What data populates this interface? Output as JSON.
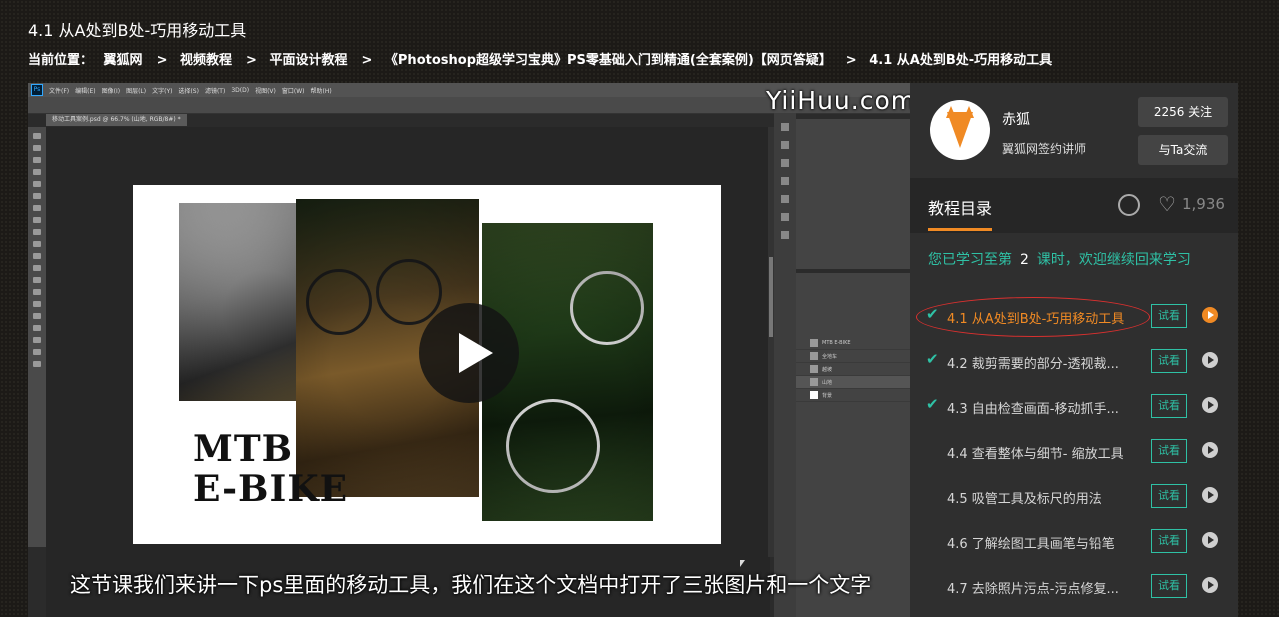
{
  "page": {
    "title": "4.1 从A处到B处-巧用移动工具",
    "breadcrumb": {
      "prefix": "当前位置：",
      "items": [
        "翼狐网",
        "视频教程",
        "平面设计教程",
        "《Photoshop超级学习宝典》PS零基础入门到精通(全套案例)【网页答疑】",
        "4.1 从A处到B处-巧用移动工具"
      ],
      "separator": ">"
    }
  },
  "player": {
    "watermark": "YiiHuu.com",
    "subtitle": "这节课我们来讲一下ps里面的移动工具，我们在这个文档中打开了三张图片和一个文字",
    "canvas_text_line1": "MTB",
    "canvas_text_line2": "E-BIKE",
    "ps_tab": "移动工具案例.psd @ 66.7% (山地, RGB/8#) *",
    "ps_menu": [
      "文件(F)",
      "编辑(E)",
      "图像(I)",
      "图层(L)",
      "文字(Y)",
      "选择(S)",
      "滤镜(T)",
      "3D(D)",
      "视图(V)",
      "窗口(W)",
      "帮助(H)"
    ],
    "ps_layers": [
      "MTB E-BIKE",
      "全地车",
      "越坡",
      "山地",
      "背景"
    ]
  },
  "teacher": {
    "name": "赤狐",
    "title": "翼狐网签约讲师",
    "follow_label": "2256 关注",
    "chat_label": "与Ta交流"
  },
  "toc": {
    "title": "教程目录",
    "likes": "1,936",
    "progress_prefix": "您已学习至第",
    "progress_num": "2",
    "progress_suffix": "课时，欢迎继续回来学习"
  },
  "lessons": [
    {
      "title": "4.1 从A处到B处-巧用移动工具",
      "done": true,
      "active": true,
      "try_label": "试看"
    },
    {
      "title": "4.2 裁剪需要的部分-透视裁...",
      "done": true,
      "active": false,
      "try_label": "试看"
    },
    {
      "title": "4.3 自由检查画面-移动抓手...",
      "done": true,
      "active": false,
      "try_label": "试看"
    },
    {
      "title": "4.4 查看整体与细节- 缩放工具",
      "done": false,
      "active": false,
      "try_label": "试看"
    },
    {
      "title": "4.5 吸管工具及标尺的用法",
      "done": false,
      "active": false,
      "try_label": "试看"
    },
    {
      "title": "4.6 了解绘图工具画笔与铅笔",
      "done": false,
      "active": false,
      "try_label": "试看"
    },
    {
      "title": "4.7 去除照片污点-污点修复...",
      "done": false,
      "active": false,
      "try_label": "试看"
    }
  ],
  "colors": {
    "accent": "#f08a24",
    "teal": "#2fc1a5",
    "highlight_ring": "#d9302f"
  }
}
